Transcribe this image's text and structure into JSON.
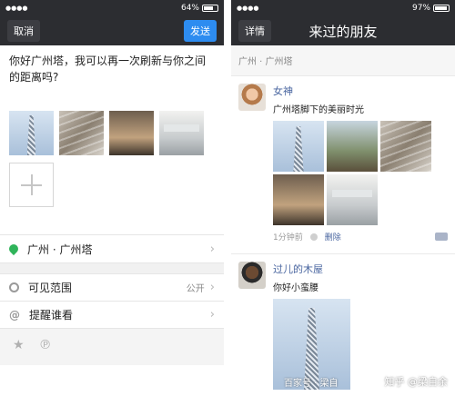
{
  "left": {
    "status": {
      "signal": "●●●●",
      "battery": "64%"
    },
    "nav": {
      "cancel": "取消",
      "send": "发送"
    },
    "compose": {
      "text": "你好广州塔，我可以再一次刷新与你之间的距离吗?"
    },
    "location": {
      "label": "广州 · 广州塔"
    },
    "visibility": {
      "label": "可见范围",
      "value": "公开"
    },
    "mention": {
      "label": "提醒谁看"
    },
    "bottom_icons": [
      "star-icon",
      "p-icon"
    ]
  },
  "right": {
    "status": {
      "signal": "●●●●",
      "battery": "97%"
    },
    "nav": {
      "back": "详情",
      "title": "来过的朋友"
    },
    "location_header": "广州 · 广州塔",
    "posts": [
      {
        "name": "女神",
        "text": "广州塔脚下的美丽时光",
        "time": "1分钟前",
        "delete": "删除"
      },
      {
        "name": "过儿的木屋",
        "text": "你好小蛮腰"
      }
    ]
  },
  "watermark": {
    "left": "百家号 · 梁自",
    "right": "知乎 @梁自余"
  }
}
